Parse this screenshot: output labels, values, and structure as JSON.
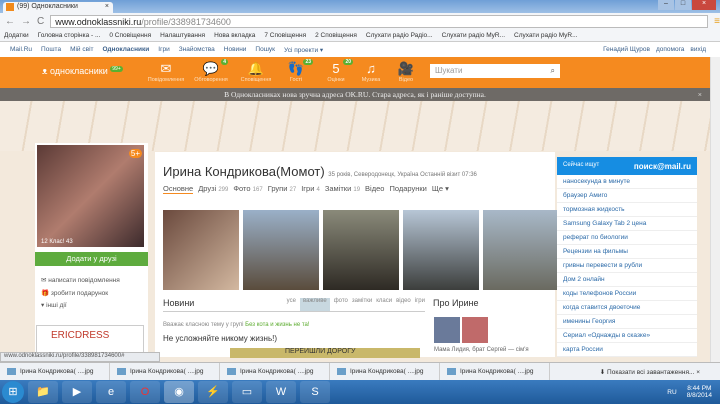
{
  "browser": {
    "tab_title": "(99) Однокласники",
    "url_host": "www.odnoklassniki.ru",
    "url_path": "/profile/338981734600",
    "bookmarks": [
      "Додатки",
      "Головна сторінка - ...",
      "0 Сповіщення",
      "Налаштування",
      "Нова вкладка",
      "7 Сповіщення",
      "2 Сповіщення",
      "Слухати радіо Радіо...",
      "Слухати радіо MyR...",
      "Слухати радіо MyR..."
    ]
  },
  "mailbar": {
    "links": [
      "Mail.Ru",
      "Пошта",
      "Мій світ",
      "Однокласники",
      "Ігри",
      "Знайомства",
      "Новини",
      "Пошук",
      "Усі проекти ▾"
    ],
    "user": "Генадий Щуров",
    "help": "допомога",
    "exit": "вихід"
  },
  "ok": {
    "logo": "однокласники",
    "logo_badge": "99+",
    "nav": [
      {
        "label": "Повідомлення",
        "icon": "✉",
        "badge": ""
      },
      {
        "label": "Обговорення",
        "icon": "💬",
        "badge": "4"
      },
      {
        "label": "Сповіщення",
        "icon": "🔔",
        "badge": ""
      },
      {
        "label": "Гості",
        "icon": "👣",
        "badge": "23"
      },
      {
        "label": "Оцінки",
        "icon": "5",
        "badge": "20"
      },
      {
        "label": "Музика",
        "icon": "♫",
        "badge": ""
      },
      {
        "label": "Відео",
        "icon": "🎥",
        "badge": ""
      }
    ],
    "search_placeholder": "Шукати"
  },
  "notice": "В Однокласниках нова зручна адреса OK.RU. Стара адреса, як і раніше доступна.",
  "profile": {
    "name": "Ирина Кондрикова(Момот)",
    "meta": "35 років, Северодонецк, Україна  Останній візит 07:36",
    "avatar_badge": "5+",
    "photo_stats": "12  Клас! 43",
    "add_friend": "Додати у друзі",
    "actions": [
      "написати повідомлення",
      "зробити подарунок",
      "інші дії"
    ],
    "tabs": [
      {
        "label": "Основне",
        "count": ""
      },
      {
        "label": "Друзі",
        "count": "299"
      },
      {
        "label": "Фото",
        "count": "167"
      },
      {
        "label": "Групи",
        "count": "27"
      },
      {
        "label": "Ігри",
        "count": "4"
      },
      {
        "label": "Замітки",
        "count": "19"
      },
      {
        "label": "Відео",
        "count": ""
      },
      {
        "label": "Подарунки",
        "count": ""
      },
      {
        "label": "Ще ▾",
        "count": ""
      }
    ]
  },
  "news": {
    "title": "Новини",
    "filters": [
      "усе",
      "важливе",
      "фото",
      "замітки",
      "класи",
      "відео",
      "ігри"
    ],
    "post_intro": "Вважає класною тему у групі ",
    "post_group": "Без кота и жизнь не та!",
    "post_text": "Не усложняйте никому жизнь!)",
    "post_image_text": "ПЕРЕЙШЛИ ДОРОГУ"
  },
  "about": {
    "title": "Про Ирине",
    "relatives": "Мама Лидия, брат Сергей — сім'я"
  },
  "ad": {
    "brand": "ERICDRESS"
  },
  "search_widget": {
    "label": "Сейчас ищут",
    "brand": "поиск@mail.ru",
    "items": [
      "наносекунда в минуте",
      "браузер Амиго",
      "тормозная жидкость",
      "Samsung Galaxy Tab 2 цена",
      "реферат по биологии",
      "Рецензии на фильмы",
      "гривны перевести в рубли",
      "Дом 2 онлайн",
      "коды телефонов России",
      "когда ставится двоеточие",
      "именины Георгия",
      "Сериал «Однажды в сказке»",
      "карта России"
    ]
  },
  "status_url": "www.odnoklassniki.ru/profile/338981734600#",
  "downloads": {
    "items": [
      "Ірина Кондрикова( ....jpg",
      "Ірина Кондрикова( ....jpg",
      "Ірина Кондрикова( ....jpg",
      "Ірина Кондрикова( ....jpg",
      "Ірина Кондрикова( ....jpg"
    ],
    "show_all": "Показати всі завантаження..."
  },
  "taskbar": {
    "lang": "RU",
    "time": "8:44 PM",
    "date": "8/8/2014"
  }
}
